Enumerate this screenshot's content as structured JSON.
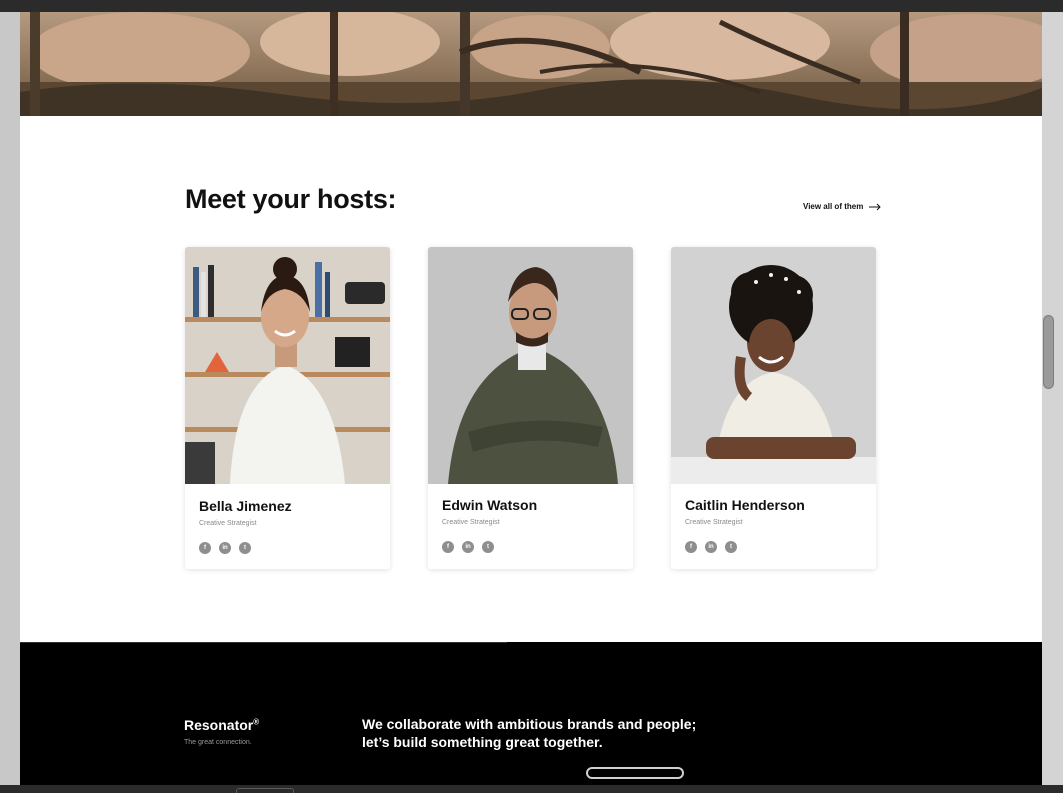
{
  "hosts_section": {
    "title": "Meet your hosts:",
    "view_all_label": "View all of them"
  },
  "hosts": [
    {
      "name": "Bella Jimenez",
      "role": "Creative Strategist"
    },
    {
      "name": "Edwin Watson",
      "role": "Creative Strategist"
    },
    {
      "name": "Caitlin Henderson",
      "role": "Creative Strategist"
    }
  ],
  "social_icons": {
    "facebook": "f",
    "linkedin": "in",
    "twitter": "t"
  },
  "footer": {
    "brand": "Resonator",
    "brand_mark": "®",
    "tagline": "The great connection.",
    "heading_line1": "We collaborate with ambitious brands and people;",
    "heading_line2": "let’s build something great together."
  },
  "icons": {
    "arrow": "arrow-right-icon",
    "facebook": "facebook-icon",
    "linkedin": "linkedin-icon",
    "twitter": "twitter-icon"
  },
  "colors": {
    "page_background": "#ffffff",
    "footer_background": "#000000",
    "social_icon": "#8e8e8e",
    "text_primary": "#111111",
    "text_muted": "#8a8a8a"
  }
}
